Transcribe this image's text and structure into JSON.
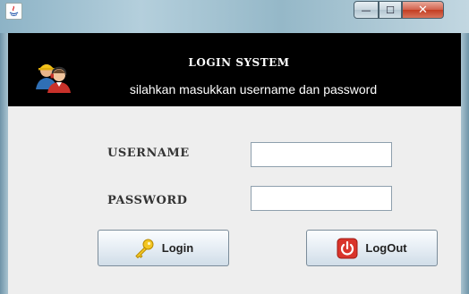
{
  "window": {
    "minimize_glyph": "—",
    "maximize_glyph": "☐",
    "close_glyph": "✕"
  },
  "header": {
    "title": "LOGIN SYSTEM",
    "subtitle": "silahkan masukkan username dan password",
    "icon": "users-icon"
  },
  "form": {
    "username_label": "USERNAME",
    "password_label": "PASSWORD",
    "username_value": "",
    "password_value": ""
  },
  "buttons": {
    "login_label": "Login",
    "login_icon": "key-icon",
    "logout_label": "LogOut",
    "logout_icon": "power-icon"
  },
  "colors": {
    "header_bg": "#000000",
    "content_bg": "#eeeeee",
    "close_button": "#c33d22",
    "logout_icon": "#d9342b",
    "key_icon": "#e6b800"
  }
}
